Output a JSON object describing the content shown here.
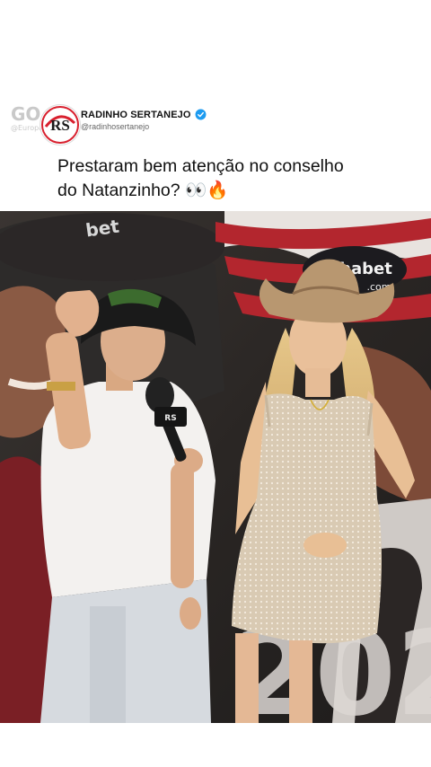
{
  "post": {
    "watermark": "GO",
    "watermark_handle": "@Europa...",
    "avatar_text": "RS",
    "account_name": "RADINHO SERTANEJO",
    "account_handle": "@radinhosertanejo",
    "caption_line1": "Prestaram bem atenção no conselho",
    "caption_line2": "do Natanzinho? 👀🔥"
  },
  "video": {
    "backdrop_brand_top": "bet",
    "backdrop_brand_right": "anhabet",
    "backdrop_brand_right_sub": ".com",
    "backdrop_number": "202",
    "mic_flag": "RS"
  },
  "colors": {
    "verified": "#1d9bf0",
    "logo_red": "#d8202e",
    "backdrop_red": "#b3262e",
    "dress": "#d8c9b4",
    "hat_tan": "#b89770"
  },
  "icons": [
    "verified-badge-icon",
    "eyes-emoji",
    "fire-emoji"
  ]
}
